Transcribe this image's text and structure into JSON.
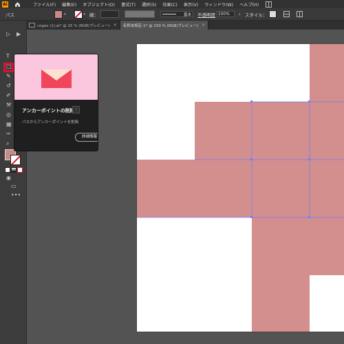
{
  "app": {
    "logo_text": "Ai"
  },
  "menubar": {
    "items": [
      "ファイル(F)",
      "編集(E)",
      "オブジェクト(O)",
      "書式(T)",
      "選択(S)",
      "効果(C)",
      "表示(V)",
      "ウィンドウ(W)",
      "ヘルプ(H)"
    ]
  },
  "controlbar": {
    "selection_label": "パス",
    "stroke_label": "線：",
    "profile_label": "基本",
    "opacity_label": "不透明度",
    "opacity_value": "100%",
    "style_label": "スタイル："
  },
  "tabs": [
    {
      "label": "cogex (1).ai* @ 25 % (RGB/プレビュー)",
      "active": false,
      "close": "×"
    },
    {
      "label": "名称未設定-1* @ 150 % (RGB/プレビュー)",
      "active": true,
      "close": "×"
    }
  ],
  "tooltip": {
    "title": "アンカーポイントの削除",
    "shortcut": "-",
    "description": "パスからアンカーポイントを削除",
    "details_button": "詳細情報"
  },
  "toolbar": {
    "more_label": "•••"
  },
  "colors": {
    "fill": "#d28f8d",
    "highlight": "#e0112f",
    "accent": "#ff9a00"
  }
}
